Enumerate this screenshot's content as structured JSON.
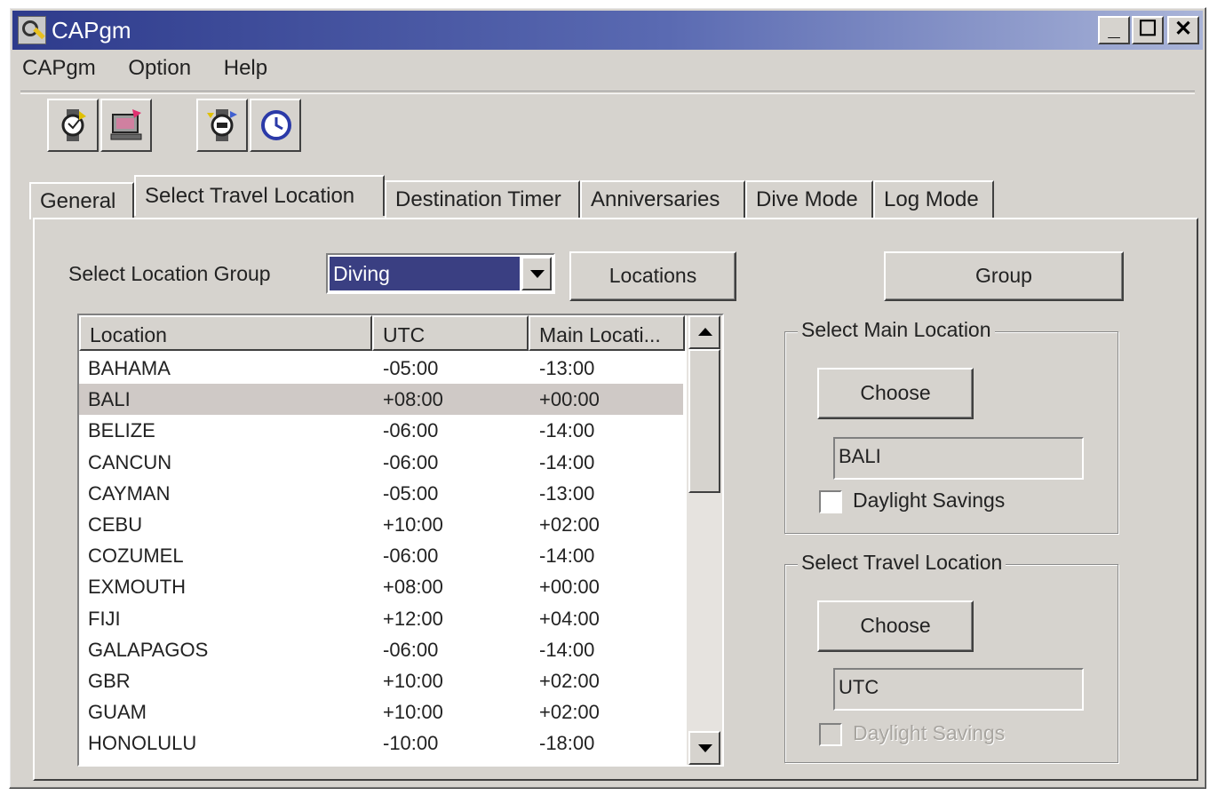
{
  "window": {
    "title": "CAPgm"
  },
  "menu": [
    "CAPgm",
    "Option",
    "Help"
  ],
  "toolbar": {
    "icons": [
      "watch-transfer-icon",
      "pc-transfer-icon",
      "watch-settings-icon",
      "clock-icon"
    ]
  },
  "tabs": [
    "General",
    "Select Travel Location",
    "Destination Timer",
    "Anniversaries",
    "Dive Mode",
    "Log Mode"
  ],
  "active_tab": "Select Travel Location",
  "location_group": {
    "label": "Select Location Group",
    "selected": "Diving"
  },
  "buttons": {
    "locations": "Locations",
    "group": "Group"
  },
  "list": {
    "columns": [
      "Location",
      "UTC",
      "Main Locati..."
    ],
    "rows": [
      {
        "location": "BAHAMA",
        "utc": "-05:00",
        "main": "-13:00"
      },
      {
        "location": "BALI",
        "utc": "+08:00",
        "main": "+00:00"
      },
      {
        "location": "BELIZE",
        "utc": "-06:00",
        "main": "-14:00"
      },
      {
        "location": "CANCUN",
        "utc": "-06:00",
        "main": "-14:00"
      },
      {
        "location": "CAYMAN",
        "utc": "-05:00",
        "main": "-13:00"
      },
      {
        "location": "CEBU",
        "utc": "+10:00",
        "main": "+02:00"
      },
      {
        "location": "COZUMEL",
        "utc": "-06:00",
        "main": "-14:00"
      },
      {
        "location": "EXMOUTH",
        "utc": "+08:00",
        "main": "+00:00"
      },
      {
        "location": "FIJI",
        "utc": "+12:00",
        "main": "+04:00"
      },
      {
        "location": "GALAPAGOS",
        "utc": "-06:00",
        "main": "-14:00"
      },
      {
        "location": "GBR",
        "utc": "+10:00",
        "main": "+02:00"
      },
      {
        "location": "GUAM",
        "utc": "+10:00",
        "main": "+02:00"
      },
      {
        "location": "HONOLULU",
        "utc": "-10:00",
        "main": "-18:00"
      }
    ],
    "selected_row": "BALI"
  },
  "main_location": {
    "group_title": "Select Main Location",
    "choose_label": "Choose",
    "value": "BALI",
    "daylight_label": "Daylight Savings",
    "daylight_checked": false
  },
  "travel_location": {
    "group_title": "Select Travel Location",
    "choose_label": "Choose",
    "value": "UTC",
    "daylight_label": "Daylight Savings",
    "daylight_checked": false,
    "daylight_enabled": false
  },
  "colors": {
    "title_bar": "#2e3b8c",
    "face": "#d6d3ce",
    "selection": "#3a3f82",
    "row_highlight": "#cfc9c6"
  }
}
